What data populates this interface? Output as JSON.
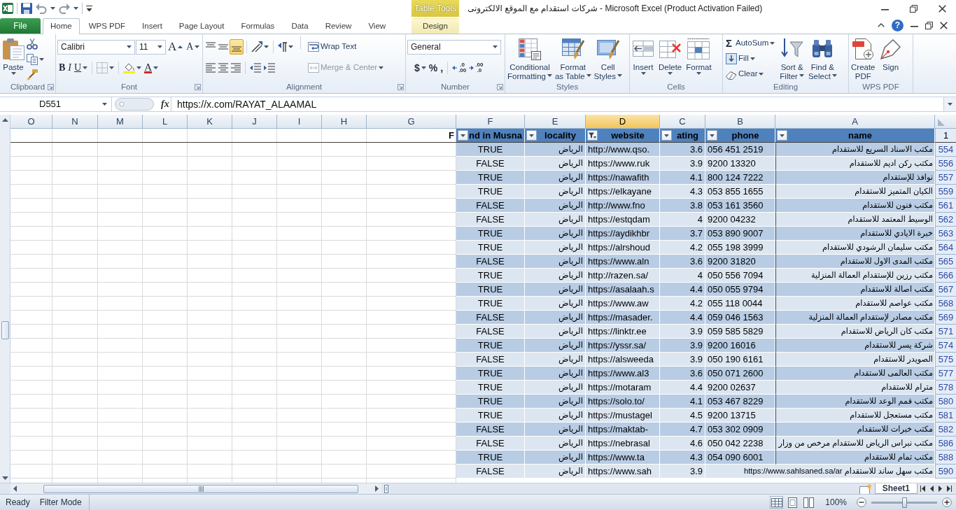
{
  "window": {
    "title": "شركات استقدام مع الموقع الالكترونى - Microsoft Excel (Product Activation Failed)",
    "help_glyph": "?"
  },
  "contextual_tab_group": {
    "label": "Table Tools"
  },
  "file_tab": {
    "label": "File"
  },
  "tabs": [
    {
      "label": "Home",
      "selected": true,
      "kind": "standard"
    },
    {
      "label": "WPS PDF",
      "selected": false,
      "kind": "standard"
    },
    {
      "label": "Insert",
      "selected": false,
      "kind": "standard"
    },
    {
      "label": "Page Layout",
      "selected": false,
      "kind": "standard"
    },
    {
      "label": "Formulas",
      "selected": false,
      "kind": "standard"
    },
    {
      "label": "Data",
      "selected": false,
      "kind": "standard"
    },
    {
      "label": "Review",
      "selected": false,
      "kind": "standard"
    },
    {
      "label": "View",
      "selected": false,
      "kind": "standard"
    },
    {
      "label": "Design",
      "selected": false,
      "kind": "contextual"
    }
  ],
  "ribbon": {
    "clipboard": {
      "label": "Clipboard",
      "paste": {
        "lines": [
          "Paste"
        ],
        "menu": true
      }
    },
    "font": {
      "label": "Font",
      "font_name": "Calibri",
      "font_size": "11",
      "grow_glyph": "A",
      "shrink_glyph": "A",
      "style_glyphs": [
        "B",
        "I",
        "U"
      ],
      "font_color_glyph": "A"
    },
    "alignment": {
      "label": "Alignment",
      "vertical": [
        {
          "selected": false
        },
        {
          "selected": false
        },
        {
          "selected": true
        }
      ],
      "wrap_text": {
        "label": "Wrap Text",
        "disabled": false
      },
      "merge": {
        "label": "Merge & Center",
        "disabled": true
      }
    },
    "number": {
      "label": "Number",
      "format": "General",
      "symbols": [
        "$",
        "%",
        ","
      ],
      "decimals": [
        [
          ".0",
          ".00"
        ],
        [
          ".00",
          ".0"
        ]
      ]
    },
    "styles": {
      "label": "Styles",
      "buttons": [
        {
          "lines": [
            "Conditional",
            "Formatting"
          ],
          "menu": true
        },
        {
          "lines": [
            "Format",
            "as Table"
          ],
          "menu": true
        },
        {
          "lines": [
            "Cell",
            "Styles"
          ],
          "menu": true
        }
      ]
    },
    "cells": {
      "label": "Cells",
      "buttons": [
        {
          "lines": [
            "Insert"
          ],
          "menu": true
        },
        {
          "lines": [
            "Delete"
          ],
          "menu": true
        },
        {
          "lines": [
            "Format"
          ],
          "menu": true
        }
      ]
    },
    "editing": {
      "label": "Editing",
      "small": [
        {
          "glyph": "Σ",
          "label": "AutoSum"
        },
        {
          "label": "Fill"
        },
        {
          "label": "Clear"
        }
      ],
      "buttons": [
        {
          "lines": [
            "Sort &",
            "Filter"
          ],
          "menu": true
        },
        {
          "lines": [
            "Find &",
            "Select"
          ],
          "menu": true
        }
      ]
    },
    "wps_pdf": {
      "label": "WPS PDF",
      "buttons": [
        {
          "lines": [
            "Create",
            "PDF"
          ],
          "menu": false
        },
        {
          "lines": [
            "Sign"
          ],
          "menu": false
        }
      ]
    }
  },
  "formula_bar": {
    "name_box": "D551",
    "function_label": "fx",
    "formula": "https://x.com/RAYAT_ALAAMAL"
  },
  "sheet": {
    "column_headers": [
      {
        "letter": "O",
        "selected": false
      },
      {
        "letter": "N",
        "selected": false
      },
      {
        "letter": "M",
        "selected": false
      },
      {
        "letter": "L",
        "selected": false
      },
      {
        "letter": "K",
        "selected": false
      },
      {
        "letter": "J",
        "selected": false
      },
      {
        "letter": "I",
        "selected": false
      },
      {
        "letter": "H",
        "selected": false
      },
      {
        "letter": "G",
        "selected": false
      },
      {
        "letter": "F",
        "selected": false
      },
      {
        "letter": "E",
        "selected": false
      },
      {
        "letter": "D",
        "selected": true
      },
      {
        "letter": "C",
        "selected": false
      },
      {
        "letter": "B",
        "selected": false
      },
      {
        "letter": "A",
        "selected": false
      }
    ],
    "table": {
      "header_row": "1",
      "columns": [
        {
          "label": "nd in Musna",
          "label_before_button": "F",
          "filtered": false
        },
        {
          "label": "locality",
          "filtered": false
        },
        {
          "label": "website",
          "filtered": true
        },
        {
          "label": "ating",
          "filtered": false
        },
        {
          "label": "phone",
          "filtered": false
        },
        {
          "label": "name",
          "filtered": false
        }
      ],
      "rows": [
        {
          "number": "554",
          "name": "مكتب الاسناد السريع للاستقدام",
          "phone": "056 451 2519",
          "column_c": "3.6",
          "website": "http://www.qso.",
          "locality": "الرياض",
          "column_f": "TRUE"
        },
        {
          "number": "556",
          "name": "مكتب ركن اديم للاستقدام",
          "phone": "9200 13320",
          "column_c": "3.9",
          "website": "https://www.ruk",
          "locality": "الرياض",
          "column_f": "FALSE"
        },
        {
          "number": "557",
          "name": "نوافذ للإستقدام",
          "phone": "800 124 7222",
          "column_c": "4.1",
          "website": "https://nawafith",
          "locality": "الرياض",
          "column_f": "TRUE"
        },
        {
          "number": "559",
          "name": "الكيان المتميز للاستقدام",
          "phone": "053 855 1655",
          "column_c": "4.3",
          "website": "https://elkayane",
          "locality": "الرياض",
          "column_f": "TRUE"
        },
        {
          "number": "561",
          "name": "مكتب فنون للاستقدام",
          "phone": "053 161 3560",
          "column_c": "3.8",
          "website": "http://www.fno",
          "locality": "الرياض",
          "column_f": "FALSE"
        },
        {
          "number": "562",
          "name": "الوسيط المعتمد للاستقدام",
          "phone": "9200 04232",
          "column_c": "4",
          "website": "https://estqdam",
          "locality": "الرياض",
          "column_f": "FALSE"
        },
        {
          "number": "563",
          "name": "خبرة الايادي للاستقدام",
          "phone": "053 890 9007",
          "column_c": "3.7",
          "website": "https://aydikhbr",
          "locality": "الرياض",
          "column_f": "TRUE"
        },
        {
          "number": "564",
          "name": "مكتب سليمان الرشودي للاستقدام",
          "phone": "055 198 3999",
          "column_c": "4.2",
          "website": "https://alrshoud",
          "locality": "الرياض",
          "column_f": "TRUE"
        },
        {
          "number": "565",
          "name": "مكتب المدى الاول للاستقدام",
          "phone": "9200 31820",
          "column_c": "3.6",
          "website": "https://www.aln",
          "locality": "الرياض",
          "column_f": "FALSE"
        },
        {
          "number": "566",
          "name": "مكتب رزين للإستقدام العمالة المنزلية",
          "phone": "050 556 7094",
          "column_c": "4",
          "website": "http://razen.sa/",
          "locality": "الرياض",
          "column_f": "TRUE"
        },
        {
          "number": "567",
          "name": "مكتب اصالة للاستقدام",
          "phone": "050 055 9794",
          "column_c": "4.4",
          "website": "https://asalaah.s",
          "locality": "الرياض",
          "column_f": "TRUE"
        },
        {
          "number": "568",
          "name": "مكتب عواصم للاستقدام",
          "phone": "055 118 0044",
          "column_c": "4.2",
          "website": "https://www.aw",
          "locality": "الرياض",
          "column_f": "TRUE"
        },
        {
          "number": "569",
          "name": "مكتب مصادر لإستقدام العمالة المنزلية",
          "phone": "059 046 1563",
          "column_c": "4.4",
          "website": "https://masader.",
          "locality": "الرياض",
          "column_f": "FALSE"
        },
        {
          "number": "571",
          "name": "مكتب كان الرياض للاستقدام",
          "phone": "059 585 5829",
          "column_c": "3.9",
          "website": "https://linktr.ee",
          "locality": "الرياض",
          "column_f": "FALSE"
        },
        {
          "number": "574",
          "name": "شركة يسر للاستقدام",
          "phone": "9200 16016",
          "column_c": "3.9",
          "website": "https://yssr.sa/",
          "locality": "الرياض",
          "column_f": "TRUE"
        },
        {
          "number": "575",
          "name": "الصويدر للاستقدام",
          "phone": "050 190 6161",
          "column_c": "3.9",
          "website": "https://alsweeda",
          "locality": "الرياض",
          "column_f": "FALSE"
        },
        {
          "number": "577",
          "name": "مكتب العالمى للاستقدام",
          "phone": "050 071 2600",
          "column_c": "3.6",
          "website": "https://www.al3",
          "locality": "الرياض",
          "column_f": "TRUE"
        },
        {
          "number": "578",
          "name": "مترام للاستقدام",
          "phone": "9200 02637",
          "column_c": "4.4",
          "website": "https://motaram",
          "locality": "الرياض",
          "column_f": "TRUE"
        },
        {
          "number": "580",
          "name": "مكتب قمم الوعد للاستقدام",
          "phone": "053 467 8229",
          "column_c": "4.1",
          "website": "https://solo.to/",
          "locality": "الرياض",
          "column_f": "TRUE"
        },
        {
          "number": "581",
          "name": "مكتب مستعجل للاستقدام",
          "phone": "9200 13715",
          "column_c": "4.5",
          "website": "https://mustagel",
          "locality": "الرياض",
          "column_f": "TRUE"
        },
        {
          "number": "582",
          "name": "مكتب خبرات للاستقدام",
          "phone": "053 302 0909",
          "column_c": "4.7",
          "website": "https://maktab-",
          "locality": "الرياض",
          "column_f": "FALSE"
        },
        {
          "number": "586",
          "name": "مكتب نبراس الرياض للاستقدام مرخص من وزار",
          "phone": "050 042 2238",
          "column_c": "4.6",
          "website": "https://nebrasal",
          "locality": "الرياض",
          "column_f": "FALSE"
        },
        {
          "number": "588",
          "name": "مكتب تمام للاستقدام",
          "phone": "054 090 6001",
          "column_c": "4.3",
          "website": "https://www.ta",
          "locality": "الرياض",
          "column_f": "TRUE"
        },
        {
          "number": "590",
          "name": "مكتب سهل ساند للاستقدام https://www.sahlsaned.sa/ar",
          "column_c": "3.9",
          "website": "https://www.sah",
          "locality": "الرياض",
          "column_f": "FALSE"
        }
      ]
    }
  },
  "sheet_tabs": [
    {
      "label": "Sheet1",
      "selected": true
    }
  ],
  "status_bar": {
    "items": [
      "Ready",
      "Filter Mode"
    ],
    "views": [
      {
        "selected": true
      },
      {
        "selected": false
      },
      {
        "selected": false
      }
    ],
    "zoom": {
      "reading": "100%",
      "level": 0.5
    }
  }
}
